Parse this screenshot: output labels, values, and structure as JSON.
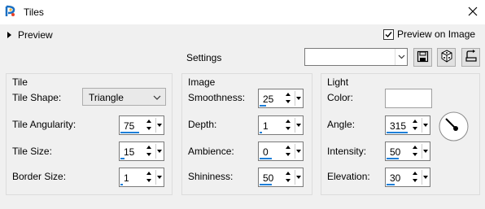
{
  "window": {
    "title": "Tiles"
  },
  "header": {
    "preview_label": "Preview",
    "preview_on_image_label": "Preview on Image",
    "preview_on_image_checked": true,
    "settings_label": "Settings",
    "settings_value": ""
  },
  "tile": {
    "title": "Tile",
    "shape_label": "Tile Shape:",
    "shape_value": "Triangle",
    "angularity_label": "Tile Angularity:",
    "angularity_value": "75",
    "angularity_fill": 0.75,
    "size_label": "Tile Size:",
    "size_value": "15",
    "size_fill": 0.15,
    "border_label": "Border Size:",
    "border_value": "1",
    "border_fill": 0.02
  },
  "image": {
    "title": "Image",
    "smoothness_label": "Smoothness:",
    "smoothness_value": "25",
    "smoothness_fill": 0.25,
    "depth_label": "Depth:",
    "depth_value": "1",
    "depth_fill": 0.02,
    "ambience_label": "Ambience:",
    "ambience_value": "0",
    "ambience_fill": 0.5,
    "shininess_label": "Shininess:",
    "shininess_value": "50",
    "shininess_fill": 0.5
  },
  "light": {
    "title": "Light",
    "color_label": "Color:",
    "color_value": "#ffffff",
    "angle_label": "Angle:",
    "angle_value": "315",
    "angle_fill": 0.875,
    "intensity_label": "Intensity:",
    "intensity_value": "50",
    "intensity_fill": 0.5,
    "elevation_label": "Elevation:",
    "elevation_value": "30",
    "elevation_fill": 0.33
  },
  "icons": {
    "app": "app-logo-icon",
    "close": "close-icon",
    "save": "save-preset-icon",
    "randomize": "randomize-dice-icon",
    "reset": "reset-icon"
  },
  "colors": {
    "accent": "#1e7fd8"
  }
}
